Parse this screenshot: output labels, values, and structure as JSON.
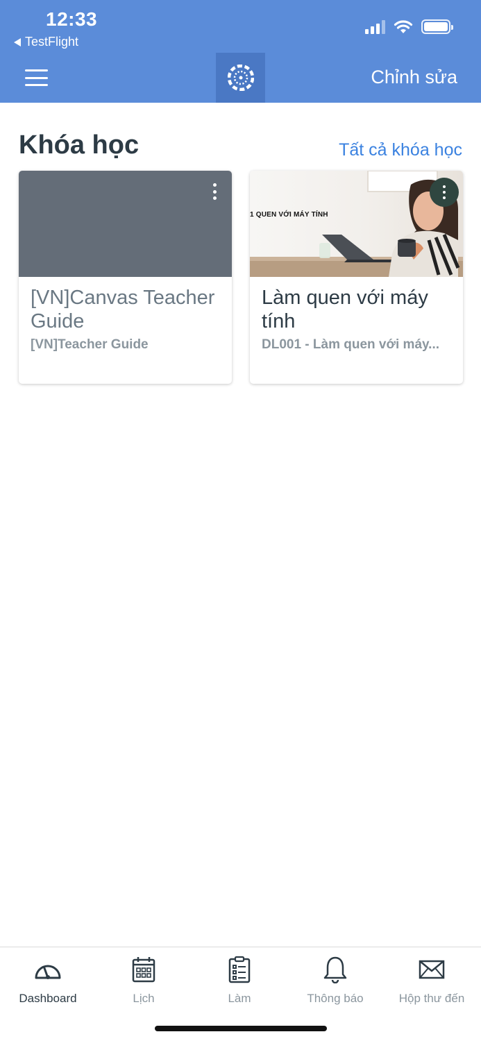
{
  "status_bar": {
    "time": "12:33",
    "back_app": "TestFlight",
    "signal_bars": 3,
    "battery_level": 1.0
  },
  "nav": {
    "edit_label": "Chỉnh sửa",
    "menu_icon": "hamburger-icon",
    "logo_icon": "canvas-logo-icon"
  },
  "courses_section": {
    "title": "Khóa học",
    "all_courses_link": "Tất cả khóa học"
  },
  "courses": [
    {
      "title": "[VN]Canvas Teacher Guide",
      "subtitle": "[VN]Teacher Guide",
      "image_color": "#646d78"
    },
    {
      "title": "Làm quen với máy tính",
      "subtitle": "DL001 - Làm quen với máy...",
      "image_caption": "1 QUEN VỚI MÁY TÍNH"
    }
  ],
  "tabbar": {
    "tabs": [
      {
        "label": "Dashboard",
        "icon": "dashboard-gauge-icon",
        "active": true
      },
      {
        "label": "Lịch",
        "icon": "calendar-icon",
        "active": false
      },
      {
        "label": "Làm",
        "icon": "todo-clipboard-icon",
        "active": false
      },
      {
        "label": "Thông báo",
        "icon": "bell-icon",
        "active": false
      },
      {
        "label": "Hộp thư đến",
        "icon": "envelope-icon",
        "active": false
      }
    ]
  },
  "colors": {
    "header": "#5b8cd9",
    "logo_box": "#4a78c4",
    "link": "#3b82e0",
    "text_dark": "#2d3b45",
    "text_muted": "#8b969e"
  }
}
